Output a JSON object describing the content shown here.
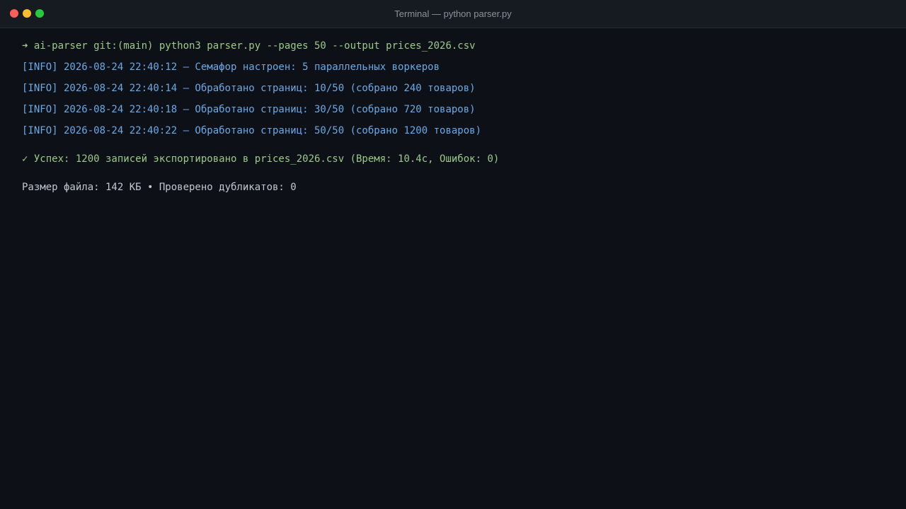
{
  "window": {
    "title": "Terminal — python parser.py"
  },
  "terminal": {
    "command_line": "➜ ai-parser git:(main) python3 parser.py --pages 50 --output prices_2026.csv",
    "log_lines": [
      "[INFO] 2026-08-24 22:40:12 — Семафор настроен: 5 параллельных воркеров",
      "[INFO] 2026-08-24 22:40:14 — Обработано страниц: 10/50 (собрано 240 товаров)",
      "[INFO] 2026-08-24 22:40:18 — Обработано страниц: 30/50 (собрано 720 товаров)",
      "[INFO] 2026-08-24 22:40:22 — Обработано страниц: 50/50 (собрано 1200 товаров)"
    ],
    "success_line": "✓ Успех: 1200 записей экспортировано в prices_2026.csv (Время: 10.4с, Ошибок: 0)",
    "stats_line": "Размер файла: 142 КБ • Проверено дубликатов: 0"
  },
  "colors": {
    "background": "#0d1117",
    "titlebar": "#161b22",
    "command": "#9cc98a",
    "info": "#6ba9e6",
    "success": "#9cc98a",
    "stats": "#c1c7cf"
  },
  "icons": [
    "close-traffic-light",
    "minimize-traffic-light",
    "zoom-traffic-light"
  ]
}
